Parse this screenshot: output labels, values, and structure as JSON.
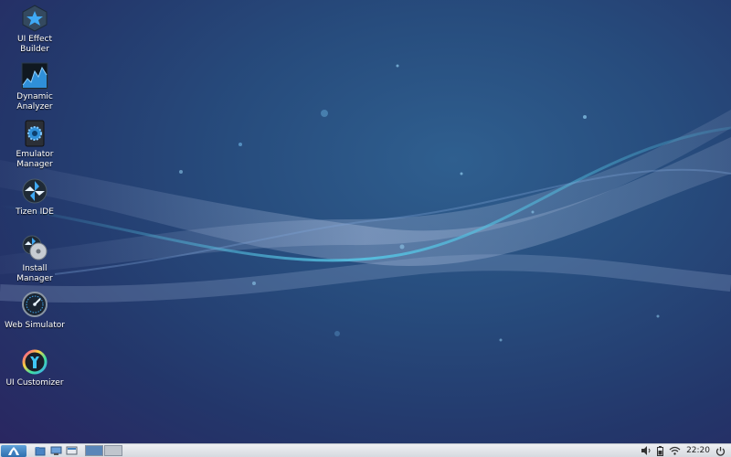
{
  "desktop": {
    "icons": [
      {
        "label": "UI Effect\nBuilder",
        "icon": "star-hexagon-icon"
      },
      {
        "label": "Dynamic\nAnalyzer",
        "icon": "waveform-chart-icon"
      },
      {
        "label": "Emulator\nManager",
        "icon": "gear-phone-icon"
      },
      {
        "label": "Tizen IDE",
        "icon": "pinwheel-icon"
      },
      {
        "label": "Install\nManager",
        "icon": "pinwheel-cd-icon"
      },
      {
        "label": "Web Simulator",
        "icon": "gauge-icon"
      },
      {
        "label": "UI Customizer",
        "icon": "ring-wrench-icon"
      }
    ]
  },
  "taskbar": {
    "clock": "22:20",
    "workspaces": [
      "active",
      "inactive"
    ]
  },
  "colors": {
    "taskbar_bg": "#e2e5ea",
    "accent": "#3a7fc0",
    "wave": "#4fb7d9"
  }
}
